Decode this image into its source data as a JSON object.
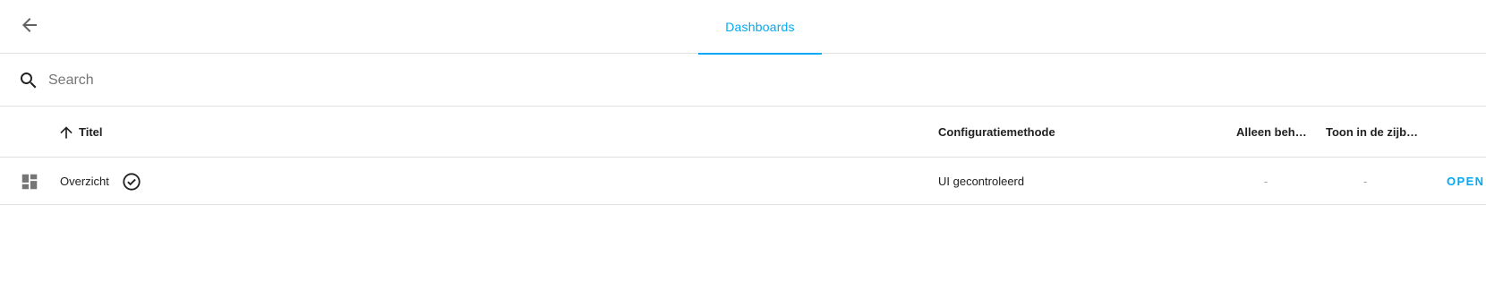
{
  "topbar": {
    "tab_label": "Dashboards",
    "accent_color": "#03a9f4",
    "back_icon": "arrow-left-icon"
  },
  "search": {
    "placeholder": "Search",
    "value": "",
    "icon": "search-icon"
  },
  "table": {
    "columns": {
      "title": "Titel",
      "config_method": "Configuratiemethode",
      "admin_only": "Alleen beh…",
      "show_in_sidebar": "Toon in de zijb…"
    },
    "sort": {
      "column": "title",
      "direction": "ascending"
    },
    "rows": [
      {
        "icon": "dashboard-icon",
        "title": "Overzicht",
        "default_badge_icon": "check-circle-icon",
        "config_method": "UI gecontroleerd",
        "admin_only": "-",
        "show_in_sidebar": "-",
        "action": "OPEN"
      }
    ]
  }
}
